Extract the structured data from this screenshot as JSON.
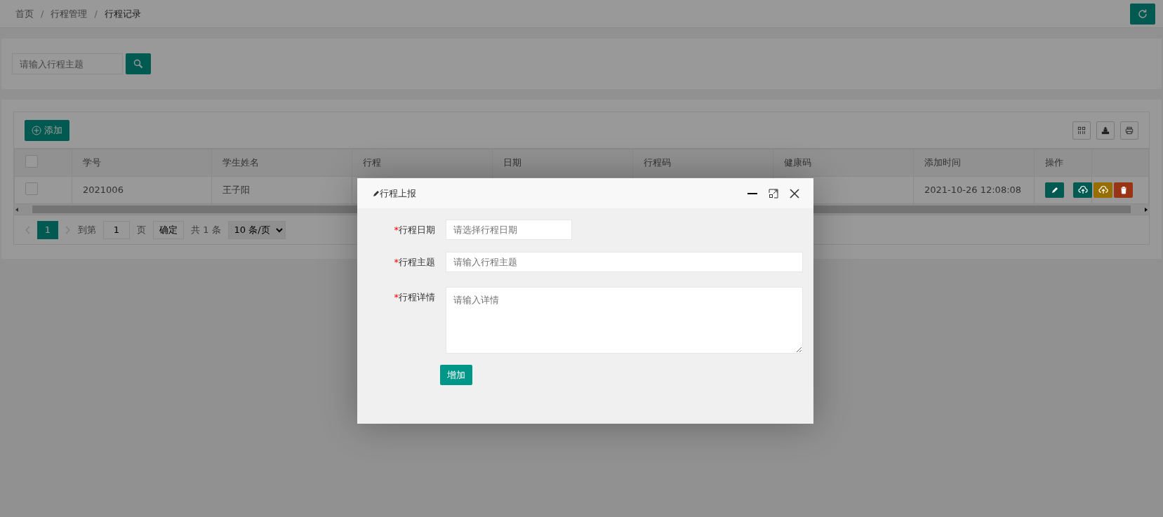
{
  "breadcrumb": [
    {
      "label": "首页",
      "current": false
    },
    {
      "separator_before": "/",
      "label": "行程管理",
      "current": false
    },
    {
      "separator_before": "/",
      "label": "行程记录",
      "current": true
    }
  ],
  "search": {
    "placeholder": "请输入行程主题"
  },
  "toolbar": {
    "add_label": "添加"
  },
  "table": {
    "header_checked": false,
    "columns": [
      "学号",
      "学生姓名",
      "行程",
      "日期",
      "行程码",
      "健康码",
      "添加时间",
      "操作"
    ],
    "rows": [
      {
        "checked": false,
        "student_id": "2021006",
        "student_name": "王子阳",
        "added_time": "2021-10-26 12:08:08",
        "actions": [
          {
            "kind": "edit",
            "color": "#005a52"
          },
          {
            "kind": "upload",
            "color": "#005a52"
          },
          {
            "kind": "upload",
            "color": "#996e00"
          },
          {
            "kind": "delete",
            "color": "#993414"
          }
        ]
      }
    ]
  },
  "pagination": {
    "pages": [
      {
        "label": "1",
        "selected": true
      }
    ],
    "goto_label": "到第",
    "goto_value": "1",
    "page_unit": "页",
    "confirm": "确定",
    "total": "共 1 条",
    "page_size": "10 条/页"
  },
  "dialog": {
    "title": "行程上报",
    "fields": [
      {
        "kind": "date",
        "required_mark": "*",
        "label": "行程日期",
        "placeholder": "请选择行程日期"
      },
      {
        "kind": "text",
        "required_mark": "*",
        "label": "行程主题",
        "placeholder": "请输入行程主题"
      },
      {
        "kind": "textarea",
        "required_mark": "*",
        "label": "行程详情",
        "placeholder": "请输入详情"
      }
    ],
    "submit": "增加"
  }
}
